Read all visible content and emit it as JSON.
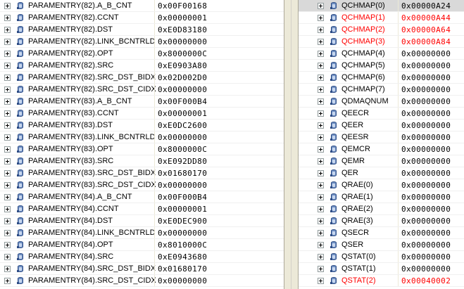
{
  "left_rows": [
    {
      "name": "PARAMENTRY(82).A_B_CNT",
      "value": "0x00F00168"
    },
    {
      "name": "PARAMENTRY(82).CCNT",
      "value": "0x00000001"
    },
    {
      "name": "PARAMENTRY(82).DST",
      "value": "0xE0D83180"
    },
    {
      "name": "PARAMENTRY(82).LINK_BCNTRLD",
      "value": "0x00000000"
    },
    {
      "name": "PARAMENTRY(82).OPT",
      "value": "0x8000000C"
    },
    {
      "name": "PARAMENTRY(82).SRC",
      "value": "0xE0903A80"
    },
    {
      "name": "PARAMENTRY(82).SRC_DST_BIDX",
      "value": "0x02D002D0"
    },
    {
      "name": "PARAMENTRY(82).SRC_DST_CIDX",
      "value": "0x00000000"
    },
    {
      "name": "PARAMENTRY(83).A_B_CNT",
      "value": "0x00F000B4"
    },
    {
      "name": "PARAMENTRY(83).CCNT",
      "value": "0x00000001"
    },
    {
      "name": "PARAMENTRY(83).DST",
      "value": "0xE0DC2600"
    },
    {
      "name": "PARAMENTRY(83).LINK_BCNTRLD",
      "value": "0x00000000"
    },
    {
      "name": "PARAMENTRY(83).OPT",
      "value": "0x8000000C"
    },
    {
      "name": "PARAMENTRY(83).SRC",
      "value": "0xE092DD80"
    },
    {
      "name": "PARAMENTRY(83).SRC_DST_BIDX",
      "value": "0x01680170"
    },
    {
      "name": "PARAMENTRY(83).SRC_DST_CIDX",
      "value": "0x00000000"
    },
    {
      "name": "PARAMENTRY(84).A_B_CNT",
      "value": "0x00F000B4"
    },
    {
      "name": "PARAMENTRY(84).CCNT",
      "value": "0x00000001"
    },
    {
      "name": "PARAMENTRY(84).DST",
      "value": "0xE0DEC900"
    },
    {
      "name": "PARAMENTRY(84).LINK_BCNTRLD",
      "value": "0x00000000"
    },
    {
      "name": "PARAMENTRY(84).OPT",
      "value": "0x8010000C"
    },
    {
      "name": "PARAMENTRY(84).SRC",
      "value": "0xE0943680"
    },
    {
      "name": "PARAMENTRY(84).SRC_DST_BIDX",
      "value": "0x01680170"
    },
    {
      "name": "PARAMENTRY(84).SRC_DST_CIDX",
      "value": "0x00000000"
    }
  ],
  "right_rows": [
    {
      "name": "QCHMAP(0)",
      "value": "0x00000A24",
      "changed": false
    },
    {
      "name": "QCHMAP(1)",
      "value": "0x00000A44",
      "changed": true
    },
    {
      "name": "QCHMAP(2)",
      "value": "0x00000A64",
      "changed": true
    },
    {
      "name": "QCHMAP(3)",
      "value": "0x00000A84",
      "changed": true
    },
    {
      "name": "QCHMAP(4)",
      "value": "0x00000000",
      "changed": false
    },
    {
      "name": "QCHMAP(5)",
      "value": "0x00000000",
      "changed": false
    },
    {
      "name": "QCHMAP(6)",
      "value": "0x00000000",
      "changed": false
    },
    {
      "name": "QCHMAP(7)",
      "value": "0x00000000",
      "changed": false
    },
    {
      "name": "QDMAQNUM",
      "value": "0x00000000",
      "changed": false
    },
    {
      "name": "QEECR",
      "value": "0x00000000",
      "changed": false
    },
    {
      "name": "QEER",
      "value": "0x00000000",
      "changed": false
    },
    {
      "name": "QEESR",
      "value": "0x00000000",
      "changed": false
    },
    {
      "name": "QEMCR",
      "value": "0x00000000",
      "changed": false
    },
    {
      "name": "QEMR",
      "value": "0x00000000",
      "changed": false
    },
    {
      "name": "QER",
      "value": "0x00000000",
      "changed": false
    },
    {
      "name": "QRAE(0)",
      "value": "0x00000000",
      "changed": false
    },
    {
      "name": "QRAE(1)",
      "value": "0x00000000",
      "changed": false
    },
    {
      "name": "QRAE(2)",
      "value": "0x00000000",
      "changed": false
    },
    {
      "name": "QRAE(3)",
      "value": "0x00000000",
      "changed": false
    },
    {
      "name": "QSECR",
      "value": "0x00000000",
      "changed": false
    },
    {
      "name": "QSER",
      "value": "0x00000000",
      "changed": false
    },
    {
      "name": "QSTAT(0)",
      "value": "0x00000000",
      "changed": false
    },
    {
      "name": "QSTAT(1)",
      "value": "0x00000000",
      "changed": false
    },
    {
      "name": "QSTAT(2)",
      "value": "0x00040002",
      "changed": true
    }
  ],
  "colors": {
    "changed": "#ff0000",
    "selected_row": "#d9d9d9"
  },
  "icons": {
    "expander": "plus-box-icon",
    "register": "register-icon"
  }
}
